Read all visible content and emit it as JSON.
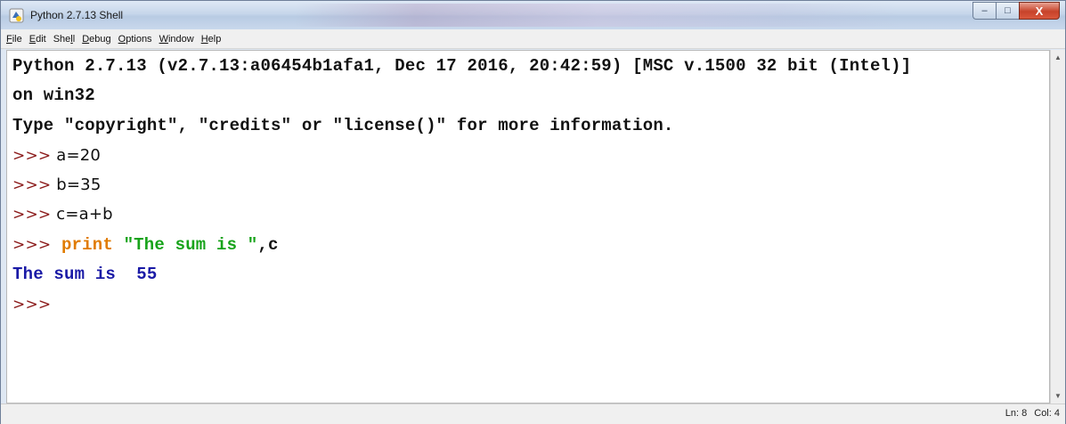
{
  "window": {
    "title": "Python 2.7.13 Shell",
    "controls": {
      "minimize": "–",
      "maximize": "□",
      "close": "X"
    }
  },
  "menu": [
    {
      "u": "F",
      "rest": "ile"
    },
    {
      "u": "E",
      "rest": "dit"
    },
    {
      "pre": "She",
      "u": "l",
      "rest": "l"
    },
    {
      "u": "D",
      "rest": "ebug"
    },
    {
      "u": "O",
      "rest": "ptions"
    },
    {
      "u": "W",
      "rest": "indow"
    },
    {
      "u": "H",
      "rest": "elp"
    }
  ],
  "shell": {
    "banner1": "Python 2.7.13 (v2.7.13:a06454b1afa1, Dec 17 2016, 20:42:59) [MSC v.1500 32 bit (Intel)]",
    "banner2": "on win32",
    "banner3": "Type \"copyright\", \"credits\" or \"license()\" for more information.",
    "prompt": ">>>",
    "cmd1": " a=20",
    "cmd2": " b=35",
    "cmd3": " c=a+b",
    "cmd4_kw": "print",
    "cmd4_str": "\"The sum is \"",
    "cmd4_rest": ",c",
    "output_label": "The sum is ",
    "output_value": "55"
  },
  "status": {
    "line": "Ln: 8",
    "col": "Col: 4"
  },
  "colors": {
    "prompt": "#8b1a1a",
    "keyword": "#e07b00",
    "string": "#17a31a",
    "output": "#1a1aa6"
  }
}
